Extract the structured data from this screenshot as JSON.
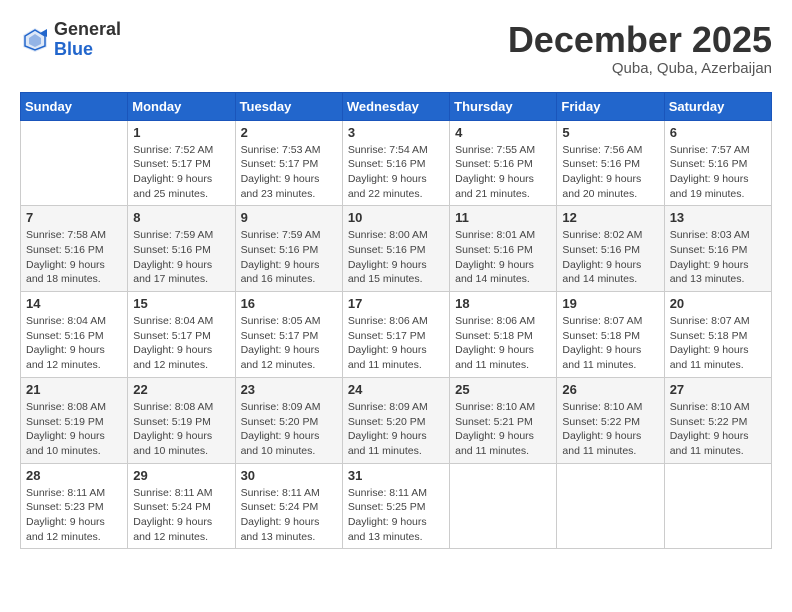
{
  "header": {
    "logo_general": "General",
    "logo_blue": "Blue",
    "month_title": "December 2025",
    "location": "Quba, Quba, Azerbaijan"
  },
  "calendar": {
    "days_of_week": [
      "Sunday",
      "Monday",
      "Tuesday",
      "Wednesday",
      "Thursday",
      "Friday",
      "Saturday"
    ],
    "weeks": [
      [
        {
          "day": "",
          "info": ""
        },
        {
          "day": "1",
          "info": "Sunrise: 7:52 AM\nSunset: 5:17 PM\nDaylight: 9 hours\nand 25 minutes."
        },
        {
          "day": "2",
          "info": "Sunrise: 7:53 AM\nSunset: 5:17 PM\nDaylight: 9 hours\nand 23 minutes."
        },
        {
          "day": "3",
          "info": "Sunrise: 7:54 AM\nSunset: 5:16 PM\nDaylight: 9 hours\nand 22 minutes."
        },
        {
          "day": "4",
          "info": "Sunrise: 7:55 AM\nSunset: 5:16 PM\nDaylight: 9 hours\nand 21 minutes."
        },
        {
          "day": "5",
          "info": "Sunrise: 7:56 AM\nSunset: 5:16 PM\nDaylight: 9 hours\nand 20 minutes."
        },
        {
          "day": "6",
          "info": "Sunrise: 7:57 AM\nSunset: 5:16 PM\nDaylight: 9 hours\nand 19 minutes."
        }
      ],
      [
        {
          "day": "7",
          "info": "Sunrise: 7:58 AM\nSunset: 5:16 PM\nDaylight: 9 hours\nand 18 minutes."
        },
        {
          "day": "8",
          "info": "Sunrise: 7:59 AM\nSunset: 5:16 PM\nDaylight: 9 hours\nand 17 minutes."
        },
        {
          "day": "9",
          "info": "Sunrise: 7:59 AM\nSunset: 5:16 PM\nDaylight: 9 hours\nand 16 minutes."
        },
        {
          "day": "10",
          "info": "Sunrise: 8:00 AM\nSunset: 5:16 PM\nDaylight: 9 hours\nand 15 minutes."
        },
        {
          "day": "11",
          "info": "Sunrise: 8:01 AM\nSunset: 5:16 PM\nDaylight: 9 hours\nand 14 minutes."
        },
        {
          "day": "12",
          "info": "Sunrise: 8:02 AM\nSunset: 5:16 PM\nDaylight: 9 hours\nand 14 minutes."
        },
        {
          "day": "13",
          "info": "Sunrise: 8:03 AM\nSunset: 5:16 PM\nDaylight: 9 hours\nand 13 minutes."
        }
      ],
      [
        {
          "day": "14",
          "info": "Sunrise: 8:04 AM\nSunset: 5:16 PM\nDaylight: 9 hours\nand 12 minutes."
        },
        {
          "day": "15",
          "info": "Sunrise: 8:04 AM\nSunset: 5:17 PM\nDaylight: 9 hours\nand 12 minutes."
        },
        {
          "day": "16",
          "info": "Sunrise: 8:05 AM\nSunset: 5:17 PM\nDaylight: 9 hours\nand 12 minutes."
        },
        {
          "day": "17",
          "info": "Sunrise: 8:06 AM\nSunset: 5:17 PM\nDaylight: 9 hours\nand 11 minutes."
        },
        {
          "day": "18",
          "info": "Sunrise: 8:06 AM\nSunset: 5:18 PM\nDaylight: 9 hours\nand 11 minutes."
        },
        {
          "day": "19",
          "info": "Sunrise: 8:07 AM\nSunset: 5:18 PM\nDaylight: 9 hours\nand 11 minutes."
        },
        {
          "day": "20",
          "info": "Sunrise: 8:07 AM\nSunset: 5:18 PM\nDaylight: 9 hours\nand 11 minutes."
        }
      ],
      [
        {
          "day": "21",
          "info": "Sunrise: 8:08 AM\nSunset: 5:19 PM\nDaylight: 9 hours\nand 10 minutes."
        },
        {
          "day": "22",
          "info": "Sunrise: 8:08 AM\nSunset: 5:19 PM\nDaylight: 9 hours\nand 10 minutes."
        },
        {
          "day": "23",
          "info": "Sunrise: 8:09 AM\nSunset: 5:20 PM\nDaylight: 9 hours\nand 10 minutes."
        },
        {
          "day": "24",
          "info": "Sunrise: 8:09 AM\nSunset: 5:20 PM\nDaylight: 9 hours\nand 11 minutes."
        },
        {
          "day": "25",
          "info": "Sunrise: 8:10 AM\nSunset: 5:21 PM\nDaylight: 9 hours\nand 11 minutes."
        },
        {
          "day": "26",
          "info": "Sunrise: 8:10 AM\nSunset: 5:22 PM\nDaylight: 9 hours\nand 11 minutes."
        },
        {
          "day": "27",
          "info": "Sunrise: 8:10 AM\nSunset: 5:22 PM\nDaylight: 9 hours\nand 11 minutes."
        }
      ],
      [
        {
          "day": "28",
          "info": "Sunrise: 8:11 AM\nSunset: 5:23 PM\nDaylight: 9 hours\nand 12 minutes."
        },
        {
          "day": "29",
          "info": "Sunrise: 8:11 AM\nSunset: 5:24 PM\nDaylight: 9 hours\nand 12 minutes."
        },
        {
          "day": "30",
          "info": "Sunrise: 8:11 AM\nSunset: 5:24 PM\nDaylight: 9 hours\nand 13 minutes."
        },
        {
          "day": "31",
          "info": "Sunrise: 8:11 AM\nSunset: 5:25 PM\nDaylight: 9 hours\nand 13 minutes."
        },
        {
          "day": "",
          "info": ""
        },
        {
          "day": "",
          "info": ""
        },
        {
          "day": "",
          "info": ""
        }
      ]
    ]
  }
}
